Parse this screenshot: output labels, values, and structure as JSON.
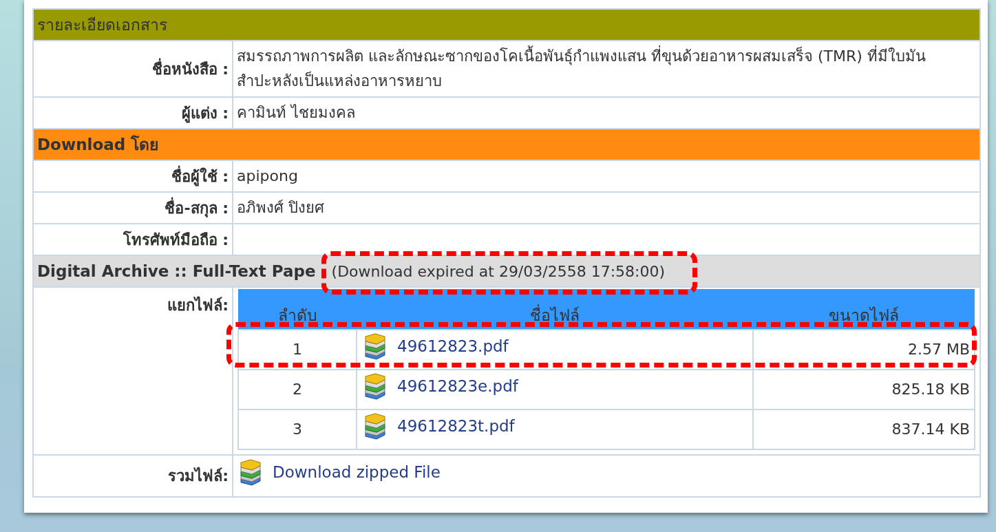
{
  "document_details": {
    "heading": "รายละเอียดเอกสาร",
    "fields": [
      {
        "label": "ชื่อหนังสือ :",
        "value": "สมรรถภาพการผลิต และลักษณะซากของโคเนื้อพันธุ์กำแพงแสน ที่ขุนด้วยอาหารผสมเสร็จ (TMR) ที่มีใบมันสำปะหลังเป็นแหล่งอาหารหยาบ"
      },
      {
        "label": "ผู้แต่ง :",
        "value": "คามินท์ ไชยมงคล"
      }
    ]
  },
  "download_by": {
    "heading": "Download โดย",
    "fields": [
      {
        "label": "ชื่อผู้ใช้ :",
        "value": "apipong"
      },
      {
        "label": "ชื่อ-สกุล :",
        "value": "อภิพงศ์ ปิงยศ"
      },
      {
        "label": "โทรศัพท์มือถือ :"
      }
    ]
  },
  "archive": {
    "heading": "Digital Archive :: Full-Text Pape",
    "expiry_note": "(Download expired at 29/03/2558 17:58:00)",
    "expiry_highlighted": true,
    "split_files_label": "แยกไฟล์:",
    "table": {
      "columns": [
        "ลำดับ",
        "ชื่อไฟล์",
        "ขนาดไฟล์"
      ],
      "rows": [
        {
          "index": "1",
          "file": "49612823.pdf",
          "size": "2.57 MB",
          "highlighted": true
        },
        {
          "index": "2",
          "file": "49612823e.pdf",
          "size": "825.18 KB",
          "highlighted": false
        },
        {
          "index": "3",
          "file": "49612823t.pdf",
          "size": "837.14 KB",
          "highlighted": false
        }
      ]
    },
    "zip_label": "รวมไฟล์:",
    "zip_link": "Download zipped File"
  }
}
